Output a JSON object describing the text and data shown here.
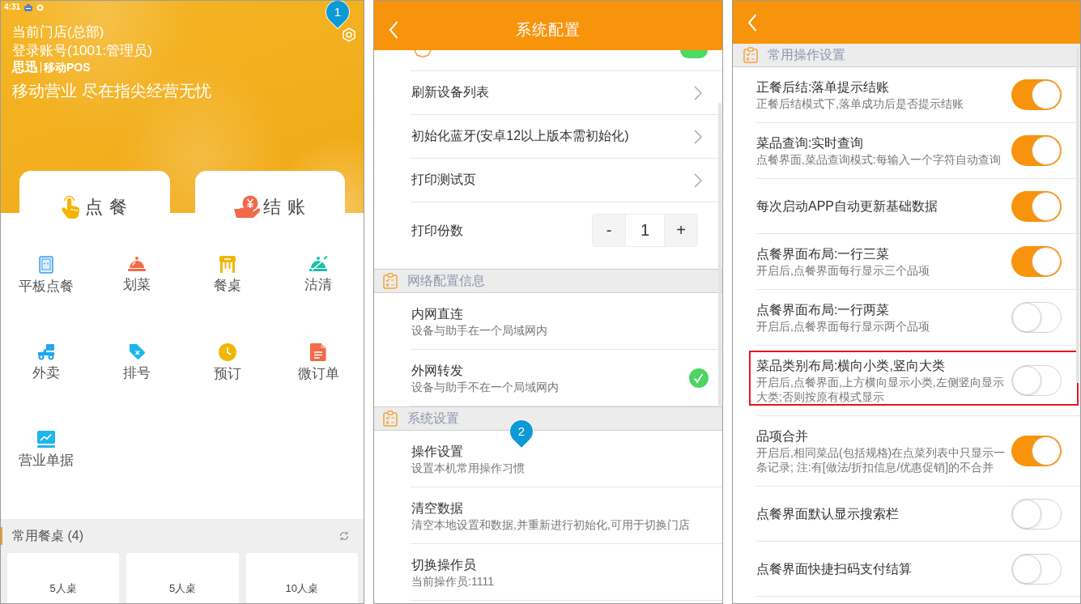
{
  "home_screen": {
    "status_bar": {
      "time": "4:31"
    },
    "marker": "1",
    "store": "当前门店(总部)",
    "account": "登录账号(1001:管理员)",
    "logo": {
      "brand": "思迅",
      "product": "移动POS"
    },
    "slogan": "移动营业 尽在指尖经营无忧",
    "main_actions": [
      {
        "label": "点 餐",
        "kind": "order"
      },
      {
        "label": "结 账",
        "kind": "checkout"
      }
    ],
    "functions": [
      {
        "label": "平板点餐",
        "kind": "tablet"
      },
      {
        "label": "划菜",
        "kind": "cloche"
      },
      {
        "label": "餐桌",
        "kind": "table"
      },
      {
        "label": "沽清",
        "kind": "cloche_slash"
      },
      {
        "label": "外卖",
        "kind": "scooter"
      },
      {
        "label": "排号",
        "kind": "tag"
      },
      {
        "label": "预订",
        "kind": "clock"
      },
      {
        "label": "微订单",
        "kind": "document"
      },
      {
        "label": "营业单据",
        "kind": "chart"
      }
    ],
    "favorite_tables": {
      "title": "常用餐桌 (4)",
      "tables": [
        "5人桌",
        "5人桌",
        "10人桌"
      ]
    }
  },
  "config_screen": {
    "title": "系统配置",
    "partial_row": {
      "on": true
    },
    "device_rows": [
      {
        "kind": "link",
        "label": "刷新设备列表"
      },
      {
        "kind": "link",
        "label": "初始化蓝牙(安卓12以上版本需初始化)"
      },
      {
        "kind": "link",
        "label": "打印测试页"
      },
      {
        "kind": "stepper",
        "label": "打印份数",
        "minus": "-",
        "value": "1",
        "plus": "+"
      }
    ],
    "sections": [
      {
        "title": "网络配置信息",
        "kind": "choice",
        "rows": [
          {
            "title": "内网直连",
            "subtitle": "设备与助手在一个局域网内",
            "selected": false
          },
          {
            "title": "外网转发",
            "subtitle": "设备与助手不在一个局域网内",
            "selected": true
          }
        ]
      },
      {
        "title": "系统设置",
        "kind": "nav",
        "rows": [
          {
            "title": "操作设置",
            "subtitle": "设置本机常用操作习惯",
            "marker": "2"
          },
          {
            "title": "清空数据",
            "subtitle": "清空本地设置和数据,并重新进行初始化,可用于切换门店"
          },
          {
            "title": "切换操作员",
            "subtitle": "当前操作员:1111"
          }
        ]
      }
    ]
  },
  "operation_screen": {
    "section": "常用操作设置",
    "settings": [
      {
        "title": "正餐后结:落单提示结账",
        "subtitle": "正餐后结模式下,落单成功后是否提示结账",
        "on": true,
        "highlighted": false
      },
      {
        "title": "菜品查询:实时查询",
        "subtitle": "点餐界面,菜品查询模式:每输入一个字符自动查询",
        "on": true,
        "highlighted": false
      },
      {
        "title": "每次启动APP自动更新基础数据",
        "on": true,
        "highlighted": false
      },
      {
        "title": "点餐界面布局:一行三菜",
        "subtitle": "开启后,点餐界面每行显示三个品项",
        "on": true,
        "highlighted": false
      },
      {
        "title": "点餐界面布局:一行两菜",
        "subtitle": "开启后,点餐界面每行显示两个品项",
        "on": false,
        "highlighted": false
      },
      {
        "title": "菜品类别布局:横向小类,竖向大类",
        "subtitle": "开启后,点餐界面,上方横向显示小类,左侧竖向显示大类;否则按原有模式显示",
        "on": false,
        "highlighted": true
      },
      {
        "title": "品项合并",
        "subtitle": "开启后,相同菜品(包括规格)在点菜列表中只显示一条记录; 注:有[做法/折扣信息/优惠促销]的不合并",
        "on": true,
        "highlighted": false
      },
      {
        "title": "点餐界面默认显示搜索栏",
        "on": false,
        "highlighted": false
      },
      {
        "title": "点餐界面快捷扫码支付结算",
        "on": false,
        "highlighted": false
      }
    ]
  }
}
